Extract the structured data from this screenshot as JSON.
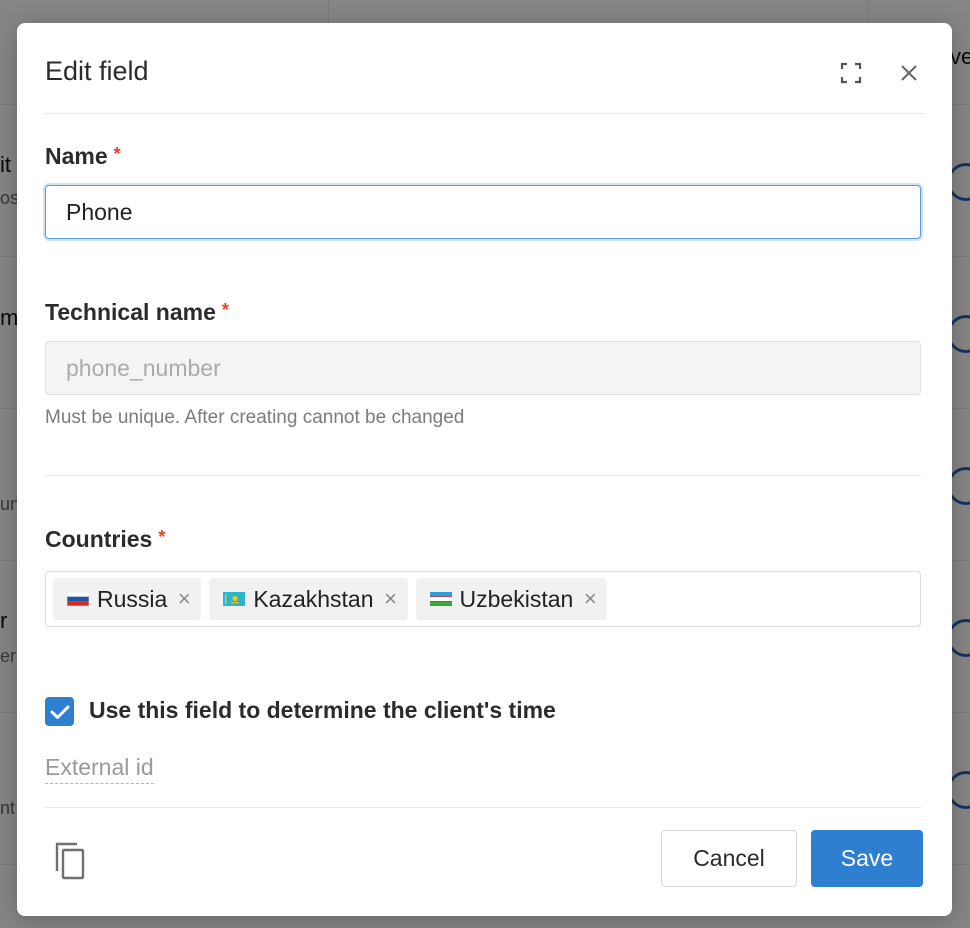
{
  "background": {
    "fragments": [
      "ve",
      "it",
      "os",
      "m",
      "un",
      "r",
      "er",
      "nt"
    ]
  },
  "dialog": {
    "title": "Edit field",
    "expand_icon": "expand-icon",
    "close_icon": "close-icon",
    "name_field": {
      "label": "Name",
      "required_mark": "*",
      "value": "Phone"
    },
    "technical_name_field": {
      "label": "Technical name",
      "required_mark": "*",
      "placeholder": "phone_number",
      "hint": "Must be unique. After creating cannot be changed"
    },
    "countries_field": {
      "label": "Countries",
      "required_mark": "*",
      "tags": [
        {
          "label": "Russia",
          "flag": "russia-flag-icon",
          "remove": "×"
        },
        {
          "label": "Kazakhstan",
          "flag": "kazakhstan-flag-icon",
          "remove": "×"
        },
        {
          "label": "Uzbekistan",
          "flag": "uzbekistan-flag-icon",
          "remove": "×"
        }
      ]
    },
    "client_time_checkbox": {
      "checked": true,
      "label": "Use this field to determine the client's time"
    },
    "external_id_link": "External id",
    "footer": {
      "copy_icon": "copy-icon",
      "cancel_label": "Cancel",
      "save_label": "Save"
    },
    "colors": {
      "primary": "#2f7fd1",
      "required": "#e0442a",
      "focus_border": "#5b9be0"
    }
  }
}
